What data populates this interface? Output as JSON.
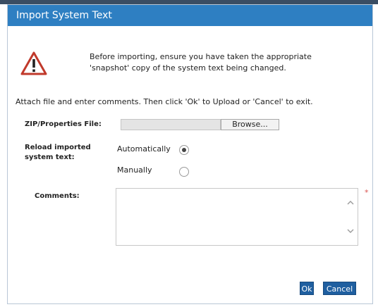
{
  "dialog": {
    "title": "Import System Text",
    "warning_line1": "Before importing, ensure you have taken the appropriate",
    "warning_line2": "'snapshot' copy of the system text being changed.",
    "instructions": "Attach file and enter comments. Then click 'Ok' to Upload or 'Cancel' to exit."
  },
  "form": {
    "file_label": "ZIP/Properties File:",
    "file_value": "",
    "browse_label": "Browse...",
    "reload_label_line1": "Reload imported",
    "reload_label_line2": "system text:",
    "reload_options": [
      {
        "label": "Automatically",
        "selected": true
      },
      {
        "label": "Manually",
        "selected": false
      }
    ],
    "comments_label": "Comments:",
    "comments_value": "",
    "required_marker": "*"
  },
  "buttons": {
    "ok": "Ok",
    "cancel": "Cancel"
  },
  "icons": {
    "warning": "warning-triangle-icon",
    "scroll_up": "chevron-up-icon",
    "scroll_down": "chevron-down-icon"
  },
  "colors": {
    "titlebar": "#2e7fc2",
    "button": "#1f5fa0",
    "warning_red": "#c0392b"
  }
}
